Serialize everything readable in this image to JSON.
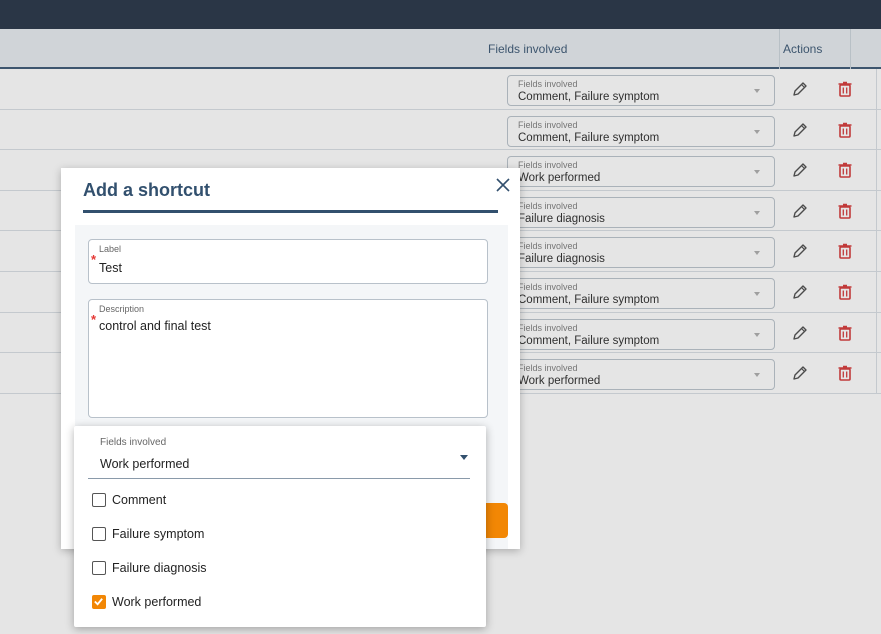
{
  "table": {
    "header": {
      "fields_involved": "Fields involved",
      "actions": "Actions"
    },
    "rows": [
      {
        "field_label": "Fields involved",
        "field_value": "Comment, Failure symptom"
      },
      {
        "field_label": "Fields involved",
        "field_value": "Comment, Failure symptom"
      },
      {
        "field_label": "Fields involved",
        "field_value": "Work performed"
      },
      {
        "field_label": "Fields involved",
        "field_value": "Failure diagnosis"
      },
      {
        "field_label": "Fields involved",
        "field_value": "Failure diagnosis"
      },
      {
        "field_label": "Fields involved",
        "field_value": "Comment, Failure symptom"
      },
      {
        "field_label": "Fields involved",
        "field_value": "Comment, Failure symptom"
      },
      {
        "field_label": "Fields involved",
        "field_value": "Work performed"
      }
    ],
    "icons": {
      "edit": "pencil-icon",
      "delete": "trash-icon"
    }
  },
  "modal": {
    "title": "Add a shortcut",
    "close_icon": "close-icon",
    "label_field": {
      "label": "Label",
      "value": "Test",
      "required_mark": "*"
    },
    "description_field": {
      "label": "Description",
      "value": "control and final test",
      "required_mark": "*"
    }
  },
  "dropdown": {
    "label": "Fields involved",
    "selected_value": "Work performed",
    "options": [
      {
        "label": "Comment",
        "checked": false
      },
      {
        "label": "Failure symptom",
        "checked": false
      },
      {
        "label": "Failure diagnosis",
        "checked": false
      },
      {
        "label": "Work performed",
        "checked": true
      }
    ]
  },
  "colors": {
    "primary": "#32506e",
    "accent": "#f28705",
    "danger": "#d32f2f",
    "required": "#e53935",
    "topbar": "#1c2a3e"
  }
}
